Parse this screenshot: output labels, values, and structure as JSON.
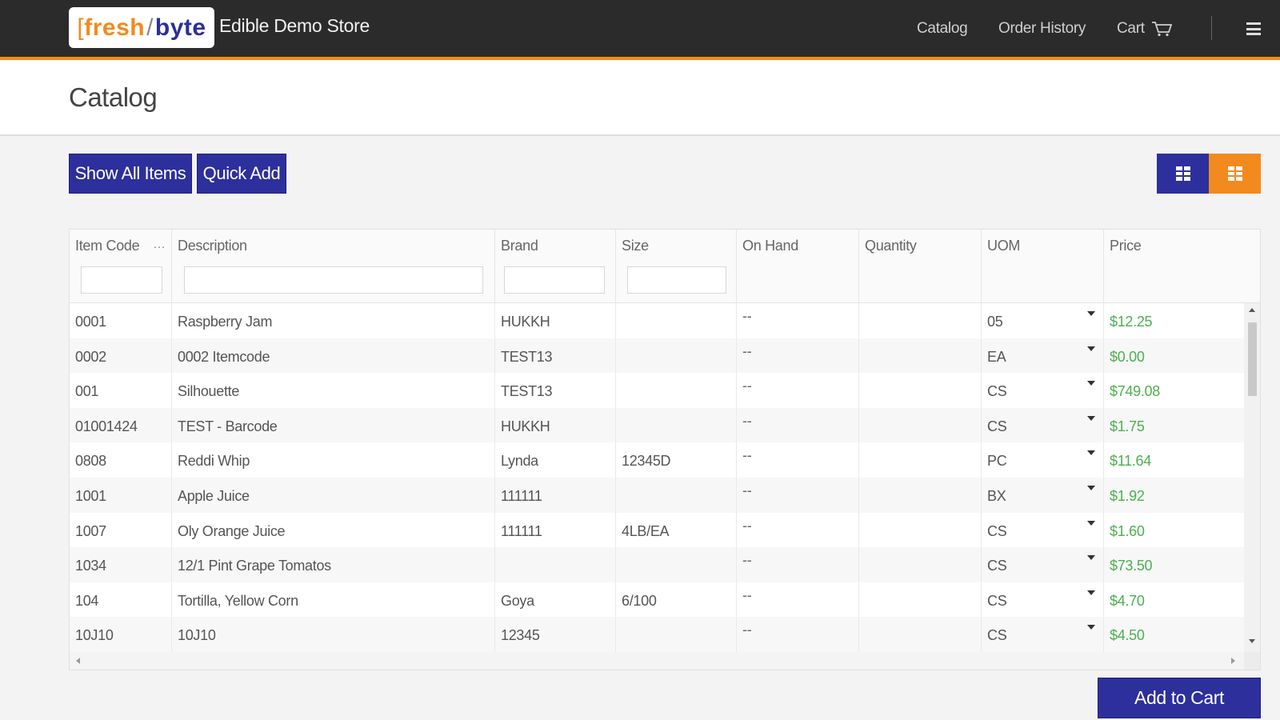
{
  "header": {
    "logo": {
      "open": "[",
      "fresh": "fresh",
      "slash": "/",
      "byte": "byte",
      "close": ""
    },
    "store_name": "Edible Demo Store",
    "nav": {
      "catalog": "Catalog",
      "order_history": "Order History",
      "cart": "Cart"
    },
    "icons": {
      "cart": "cart-icon",
      "menu": "hamburger-menu-icon"
    }
  },
  "page": {
    "title": "Catalog"
  },
  "toolbar": {
    "show_all_label": "Show All Items",
    "quick_add_label": "Quick Add",
    "view_modes": [
      "grid-view-icon",
      "list-view-icon"
    ],
    "active_view": "list"
  },
  "table": {
    "columns": [
      "Item Code",
      "Description",
      "Brand",
      "Size",
      "On Hand",
      "Quantity",
      "UOM",
      "Price"
    ],
    "filters": {
      "item_code": "",
      "description": "",
      "brand": "",
      "size": ""
    },
    "rows": [
      {
        "item_code": "0001",
        "description": "Raspberry Jam",
        "brand": "HUKKH",
        "size": "",
        "on_hand": "--",
        "quantity": "",
        "uom": "05",
        "price": "$12.25"
      },
      {
        "item_code": "0002",
        "description": "0002 Itemcode",
        "brand": "TEST13",
        "size": "",
        "on_hand": "--",
        "quantity": "",
        "uom": "EA",
        "price": "$0.00"
      },
      {
        "item_code": "001",
        "description": "Silhouette",
        "brand": "TEST13",
        "size": "",
        "on_hand": "--",
        "quantity": "",
        "uom": "CS",
        "price": "$749.08"
      },
      {
        "item_code": "01001424",
        "description": "TEST - Barcode",
        "brand": "HUKKH",
        "size": "",
        "on_hand": "--",
        "quantity": "",
        "uom": "CS",
        "price": "$1.75"
      },
      {
        "item_code": "0808",
        "description": "Reddi Whip",
        "brand": "Lynda",
        "size": "12345D",
        "on_hand": "--",
        "quantity": "",
        "uom": "PC",
        "price": "$11.64"
      },
      {
        "item_code": "1001",
        "description": "Apple Juice",
        "brand": "111111",
        "size": "",
        "on_hand": "--",
        "quantity": "",
        "uom": "BX",
        "price": "$1.92"
      },
      {
        "item_code": "1007",
        "description": "Oly Orange Juice",
        "brand": "111111",
        "size": "4LB/EA",
        "on_hand": "--",
        "quantity": "",
        "uom": "CS",
        "price": "$1.60"
      },
      {
        "item_code": "1034",
        "description": "12/1 Pint Grape Tomatos",
        "brand": "",
        "size": "",
        "on_hand": "--",
        "quantity": "",
        "uom": "CS",
        "price": "$73.50"
      },
      {
        "item_code": "104",
        "description": "Tortilla, Yellow Corn",
        "brand": "Goya",
        "size": "6/100",
        "on_hand": "--",
        "quantity": "",
        "uom": "CS",
        "price": "$4.70"
      },
      {
        "item_code": "10J10",
        "description": "10J10",
        "brand": "12345",
        "size": "",
        "on_hand": "--",
        "quantity": "",
        "uom": "CS",
        "price": "$4.50"
      }
    ]
  },
  "footer": {
    "add_to_cart_label": "Add to Cart"
  },
  "colors": {
    "topbar": "#2b2b2b",
    "accent_orange": "#f28a1e",
    "primary_blue": "#2d2f9c",
    "price_green": "#4caf50"
  }
}
